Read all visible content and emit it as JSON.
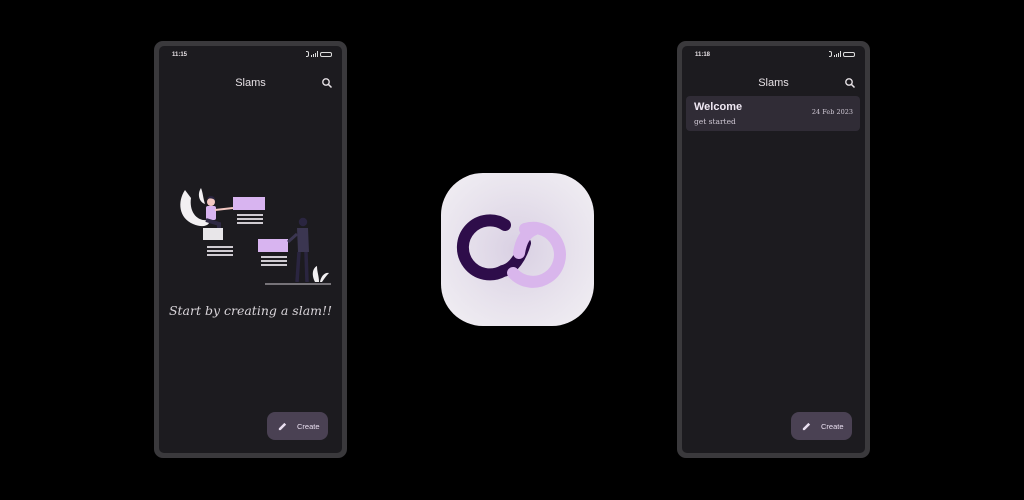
{
  "left_phone": {
    "status": {
      "time": "11:15",
      "battery": "89"
    },
    "appbar": {
      "title": "Slams"
    },
    "empty_state": {
      "message": "Start by creating a slam!!"
    },
    "fab": {
      "label": "Create",
      "icon": "pencil-icon"
    }
  },
  "right_phone": {
    "status": {
      "time": "11:18",
      "battery": "88"
    },
    "appbar": {
      "title": "Slams"
    },
    "notes": [
      {
        "title": "Welcome",
        "subtitle": "get started",
        "date": "24 Feb 2023"
      }
    ],
    "fab": {
      "label": "Create",
      "icon": "pencil-icon"
    }
  },
  "logo": {
    "icon": "app-logo-icon",
    "colors": {
      "dark": "#2e0d4a",
      "light": "#d9b6ec"
    }
  },
  "theme": {
    "background": "#000000",
    "surface": "#1c1b1f",
    "accent": "#d8b4f0",
    "fab": "#4a4153"
  }
}
